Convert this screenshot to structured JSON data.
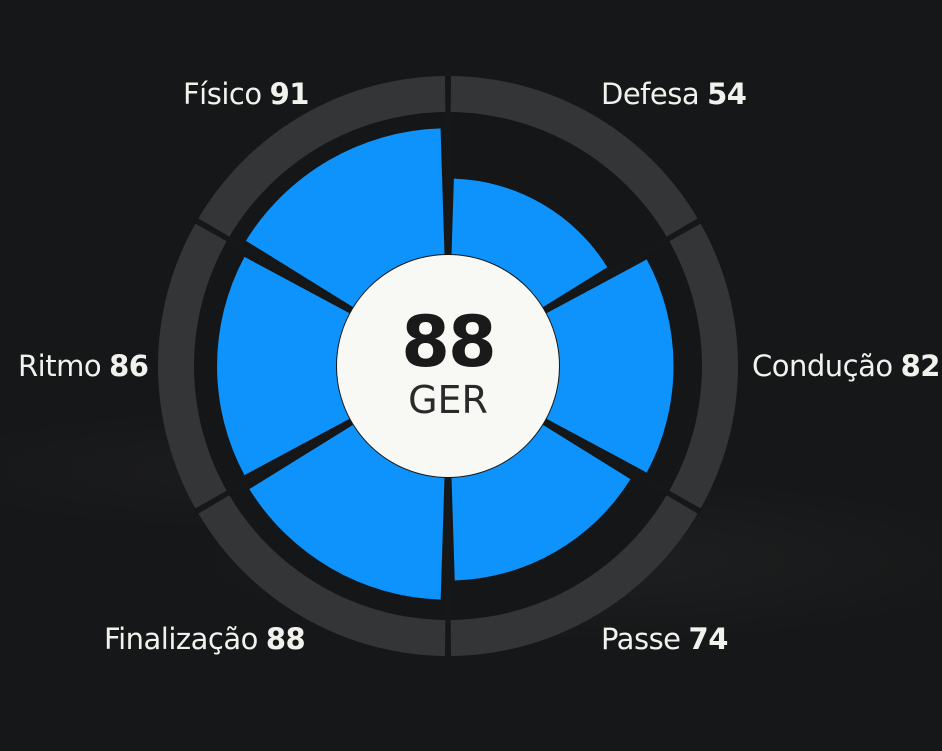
{
  "chart_data": {
    "type": "radial-bar",
    "max": 100,
    "overall": {
      "value": "88",
      "label": "GER"
    },
    "stats": [
      {
        "name": "Defesa",
        "value": 54
      },
      {
        "name": "Condução",
        "value": 82
      },
      {
        "name": "Passe",
        "value": 74
      },
      {
        "name": "Finalização",
        "value": 88
      },
      {
        "name": "Ritmo",
        "value": 86
      },
      {
        "name": "Físico",
        "value": 91
      }
    ]
  },
  "colors": {
    "background": "#161718",
    "fill": "#0d93fb",
    "track": "#333536",
    "center": "#f8f9f4",
    "text": "#f1f1ee"
  }
}
